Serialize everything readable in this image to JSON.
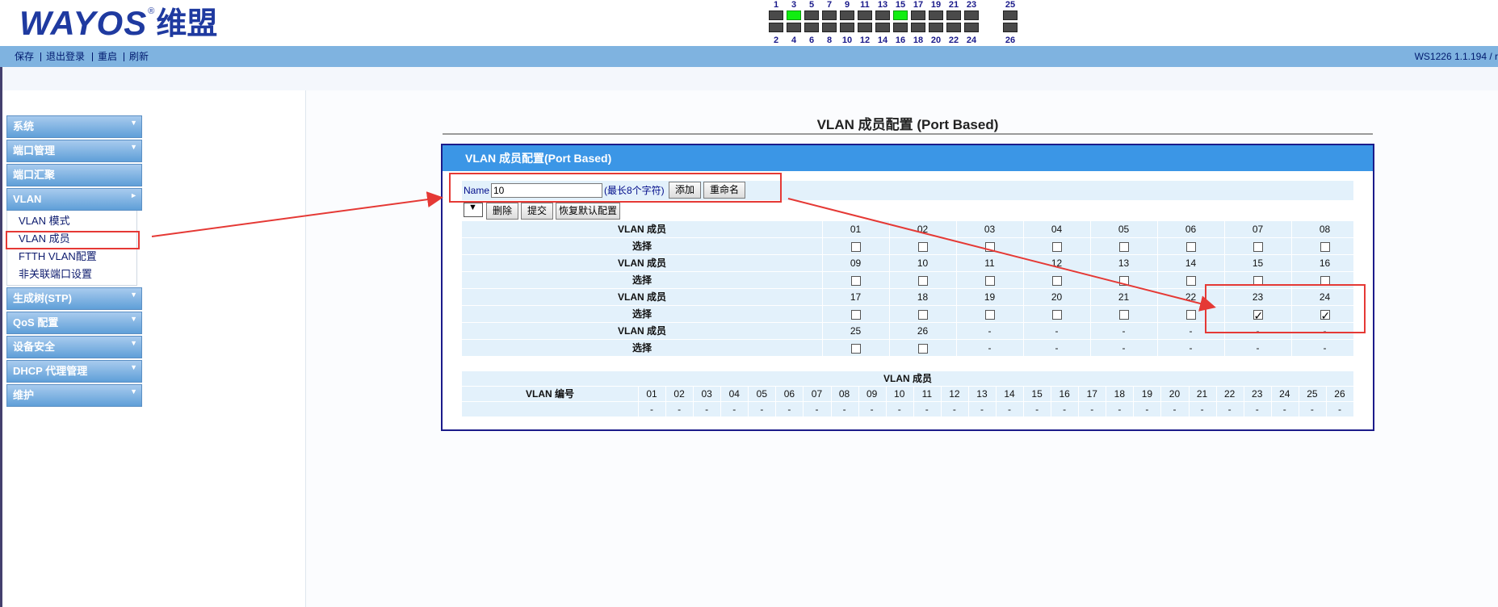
{
  "logo": {
    "brand": "WAYOS",
    "reg": "®",
    "cn": "维盟"
  },
  "ports": {
    "top": [
      "1",
      "3",
      "5",
      "7",
      "9",
      "11",
      "13",
      "15",
      "17",
      "19",
      "21",
      "23",
      "25"
    ],
    "bottom": [
      "2",
      "4",
      "6",
      "8",
      "10",
      "12",
      "14",
      "16",
      "18",
      "20",
      "22",
      "24",
      "26"
    ],
    "active": [
      "3",
      "15"
    ]
  },
  "menubar": {
    "links": [
      "保存",
      "退出登录",
      "重启",
      "刷新"
    ],
    "device_info": "WS1226   1.1.194 / r"
  },
  "sidebar": {
    "items": [
      {
        "label": "系统",
        "arrow": "▼"
      },
      {
        "label": "端口管理",
        "arrow": "▼"
      },
      {
        "label": "端口汇聚",
        "arrow": ""
      },
      {
        "label": "VLAN",
        "arrow": "►"
      },
      {
        "label": "生成树(STP)",
        "arrow": "▼"
      },
      {
        "label": "QoS 配置",
        "arrow": "▼"
      },
      {
        "label": "设备安全",
        "arrow": "▼"
      },
      {
        "label": "DHCP 代理管理",
        "arrow": "▼"
      },
      {
        "label": "维护",
        "arrow": "▼"
      }
    ],
    "vlan_sub": [
      "VLAN 模式",
      "VLAN 成员",
      "FTTH VLAN配置",
      "非关联端口设置"
    ]
  },
  "main": {
    "page_title": "VLAN 成员配置 (Port Based)",
    "panel_title": "VLAN 成员配置(Port Based)",
    "name_label": "Name",
    "name_value": "10",
    "name_hint": "(最长8个字符)",
    "add_button": "添加",
    "rename_button": "重命名",
    "delete_button": "删除",
    "submit_button": "提交",
    "restore_button": "恢复默认配置",
    "select_arrow": "▼",
    "member_label": "VLAN 成员",
    "select_label": "选择",
    "grid": [
      {
        "ports": [
          "01",
          "02",
          "03",
          "04",
          "05",
          "06",
          "07",
          "08"
        ],
        "checked": [
          false,
          false,
          false,
          false,
          false,
          false,
          false,
          false
        ]
      },
      {
        "ports": [
          "09",
          "10",
          "11",
          "12",
          "13",
          "14",
          "15",
          "16"
        ],
        "checked": [
          false,
          false,
          false,
          false,
          false,
          false,
          false,
          false
        ]
      },
      {
        "ports": [
          "17",
          "18",
          "19",
          "20",
          "21",
          "22",
          "23",
          "24"
        ],
        "checked": [
          false,
          false,
          false,
          false,
          false,
          false,
          true,
          true
        ]
      },
      {
        "ports": [
          "25",
          "26",
          "-",
          "-",
          "-",
          "-",
          "-",
          "-"
        ],
        "checked": [
          false,
          false,
          null,
          null,
          null,
          null,
          null,
          null
        ]
      }
    ],
    "summary": {
      "title": "VLAN 成员",
      "id_label": "VLAN 编号",
      "ports": [
        "01",
        "02",
        "03",
        "04",
        "05",
        "06",
        "07",
        "08",
        "09",
        "10",
        "11",
        "12",
        "13",
        "14",
        "15",
        "16",
        "17",
        "18",
        "19",
        "20",
        "21",
        "22",
        "23",
        "24",
        "25",
        "26"
      ],
      "values": [
        "-",
        "-",
        "-",
        "-",
        "-",
        "-",
        "-",
        "-",
        "-",
        "-",
        "-",
        "-",
        "-",
        "-",
        "-",
        "-",
        "-",
        "-",
        "-",
        "-",
        "-",
        "-",
        "-",
        "-",
        "-",
        "-"
      ],
      "id_value": ""
    }
  },
  "colors": {
    "annotation": "#e53935",
    "menubar": "#7fb3e0",
    "panel_header": "#3b96e6",
    "grid": "#e3f1fb"
  }
}
